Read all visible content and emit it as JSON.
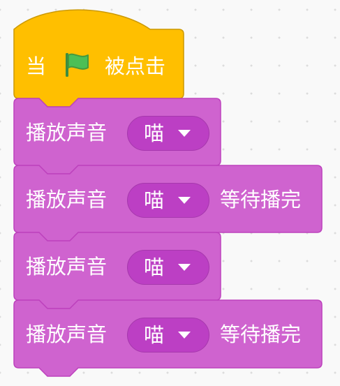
{
  "hat_block": {
    "prefix": "当",
    "icon": "green-flag-icon",
    "suffix": "被点击",
    "color": "#ffbf00"
  },
  "sound_blocks": [
    {
      "label": "播放声音",
      "sound": "喵",
      "suffix": ""
    },
    {
      "label": "播放声音",
      "sound": "喵",
      "suffix": "等待播完"
    },
    {
      "label": "播放声音",
      "sound": "喵",
      "suffix": ""
    },
    {
      "label": "播放声音",
      "sound": "喵",
      "suffix": "等待播完"
    }
  ],
  "colors": {
    "sound_block": "#cf63cf",
    "sound_block_border": "#bd42bd",
    "menu_pill": "#bc3fc4",
    "flag": "#4cbf56"
  }
}
